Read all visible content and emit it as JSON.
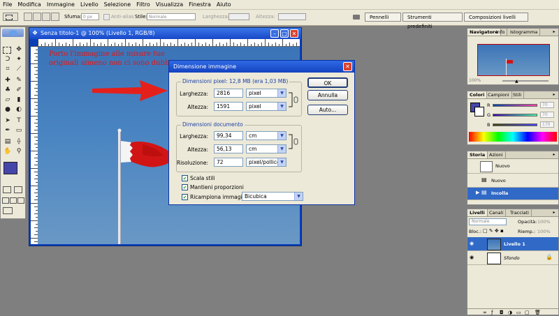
{
  "menu": [
    "File",
    "Modifica",
    "Immagine",
    "Livello",
    "Selezione",
    "Filtro",
    "Visualizza",
    "Finestra",
    "Aiuto"
  ],
  "options": {
    "sfuma_label": "Sfuma:",
    "sfuma_value": "0 px",
    "antialias_label": "Anti-alias",
    "stile_label": "Stile:",
    "stile_value": "Normale",
    "larghezza_label": "Larghezza:",
    "altezza_label": "Altezza:",
    "well_tabs": [
      "Pennelli",
      "Strumenti predefiniti",
      "Composizioni livelli"
    ]
  },
  "document": {
    "title": "Senza titolo-1 @ 100% (Livello 1, RGB/8)",
    "note": "Porto l'immagine alle misure tue originali almeno non ci sono dubbi"
  },
  "dialog": {
    "title": "Dimensione immagine",
    "pixel_group": "Dimensioni pixel:  12,8 MB (era 1,03 MB)",
    "larghezza_label": "Larghezza:",
    "larghezza_px": "2816",
    "altezza_label": "Altezza:",
    "altezza_px": "1591",
    "unit_px": "pixel",
    "doc_group": "Dimensioni documento",
    "doc_larghezza": "99,34",
    "doc_altezza": "56,13",
    "unit_cm": "cm",
    "risoluzione_label": "Risoluzione:",
    "risoluzione": "72",
    "unit_res": "pixel/pollice",
    "scala_stili": "Scala stili",
    "mantieni": "Mantieni proporzioni",
    "ricampiona": "Ricampiona immagine:",
    "ricampiona_value": "Bicubica",
    "ok": "OK",
    "annulla": "Annulla",
    "auto": "Auto..."
  },
  "navigator": {
    "tabs": [
      "Navigatore",
      "Info",
      "Istogramma"
    ],
    "zoom": "100%"
  },
  "colors": {
    "tabs": [
      "Colori",
      "Campioni",
      "Stili"
    ],
    "r_label": "R",
    "g_label": "G",
    "b_label": "B",
    "r": "70",
    "g": "70",
    "b": "170",
    "foreground": "#4646aa"
  },
  "history": {
    "tabs": [
      "Storia",
      "Azioni"
    ],
    "snapshot": "Nuovo",
    "items": [
      "Nuovo",
      "Incolla"
    ]
  },
  "layers": {
    "tabs": [
      "Livelli",
      "Canali",
      "Tracciati"
    ],
    "mode": "Normale",
    "opacity_label": "Opacità:",
    "opacity": "100%",
    "lock_label": "Bloc.:",
    "fill_label": "Riemp.:",
    "fill": "100%",
    "items": [
      "Livello 1",
      "Sfondo"
    ]
  }
}
